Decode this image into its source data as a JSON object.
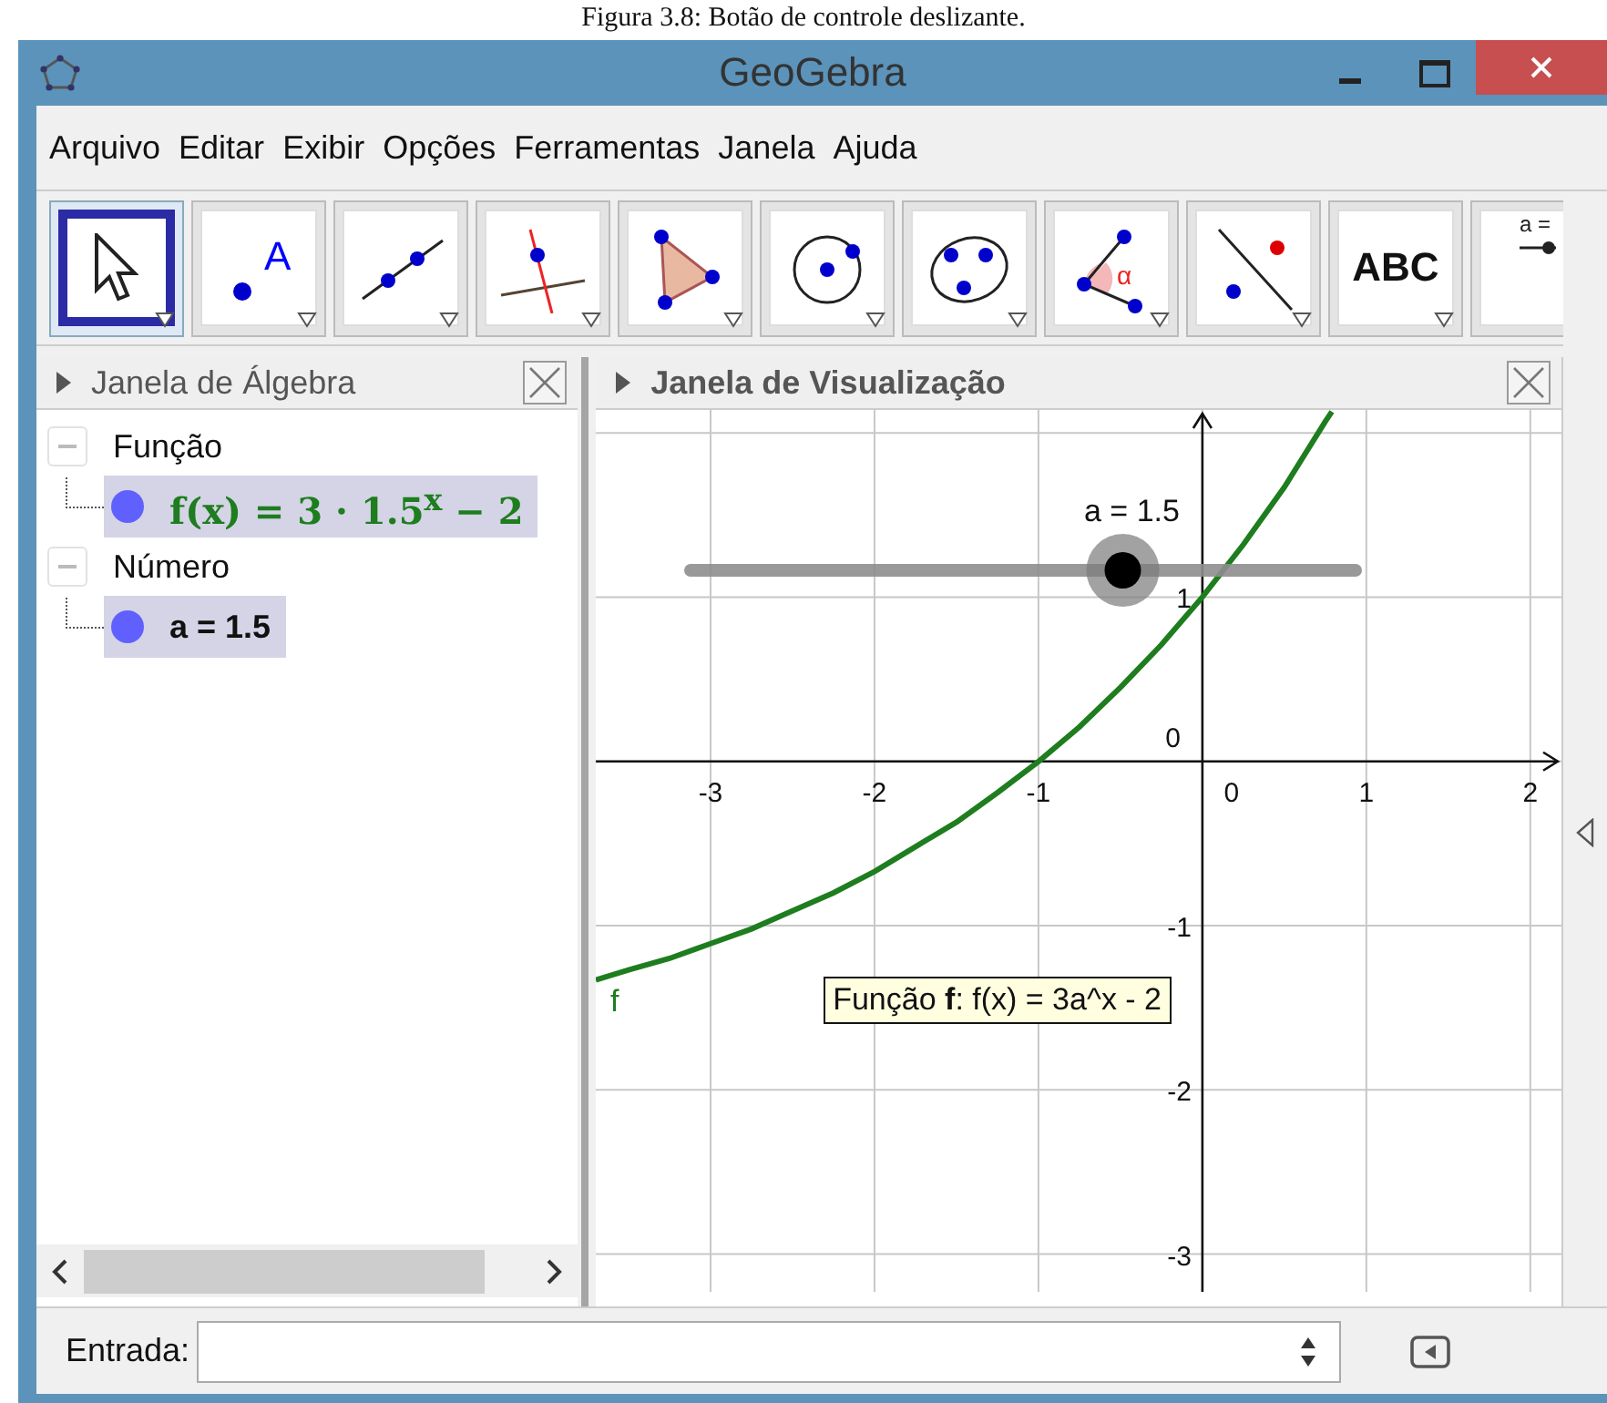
{
  "caption": "Figura 3.8: Botão de controle deslizante.",
  "window": {
    "title": "GeoGebra"
  },
  "menu": [
    "Arquivo",
    "Editar",
    "Exibir",
    "Opções",
    "Ferramentas",
    "Janela",
    "Ajuda"
  ],
  "tools": [
    {
      "kind": "move",
      "selected": true
    },
    {
      "kind": "point",
      "text": "A",
      "selected": false
    },
    {
      "kind": "line",
      "selected": false
    },
    {
      "kind": "perpendicular",
      "selected": false
    },
    {
      "kind": "polygon",
      "selected": false
    },
    {
      "kind": "circle",
      "selected": false
    },
    {
      "kind": "conic",
      "selected": false
    },
    {
      "kind": "angle",
      "text": "α",
      "selected": false
    },
    {
      "kind": "reflect",
      "selected": false
    },
    {
      "kind": "text",
      "text": "ABC",
      "selected": false
    },
    {
      "kind": "slider",
      "text": "a =",
      "selected": false
    }
  ],
  "algebra": {
    "title": "Janela de Álgebra",
    "groups": [
      {
        "label": "Função",
        "expanded": true,
        "children": [
          {
            "text": "f(x) = 3 · 1.5$^{x}$ − 2",
            "kind": "function",
            "color": "#6060ff",
            "selected": true
          }
        ]
      },
      {
        "label": "Número",
        "expanded": true,
        "children": [
          {
            "text": "a = 1.5",
            "kind": "number",
            "color": "#6060ff",
            "selected": true
          }
        ]
      }
    ]
  },
  "graphics": {
    "title": "Janela de Visualização",
    "slider": {
      "label": "a = 1.5",
      "level": 0.65
    },
    "origin_labels": [
      "0",
      "0"
    ],
    "tooltip": "Função **f**: f(x) = 3a^x - 2",
    "chart_data": {
      "type": "line",
      "x": [
        -3.7,
        -3.5,
        -3.25,
        -3,
        -2.75,
        -2.5,
        -2.25,
        -2,
        -1.75,
        -1.5,
        -1.25,
        -1,
        -0.75,
        -0.5,
        -0.25,
        0,
        0.25,
        0.5,
        0.75,
        0.79
      ],
      "series": [
        {
          "name": "f",
          "color": "#1e7d1e",
          "values": [
            -1.33,
            -1.27,
            -1.2,
            -1.11,
            -1.02,
            -0.91,
            -0.8,
            -0.67,
            -0.52,
            -0.37,
            -0.19,
            0,
            0.21,
            0.45,
            0.71,
            1,
            1.32,
            1.67,
            2.07,
            2.13
          ]
        }
      ],
      "grid": true,
      "xlim": [
        -3.7,
        2.19
      ],
      "ylim": [
        -3.23,
        2.14
      ],
      "xticks": [
        -3,
        -2,
        -1,
        1,
        2
      ],
      "yticks": [
        -3,
        -2,
        -1,
        1
      ]
    }
  },
  "input": {
    "label": "Entrada:"
  }
}
